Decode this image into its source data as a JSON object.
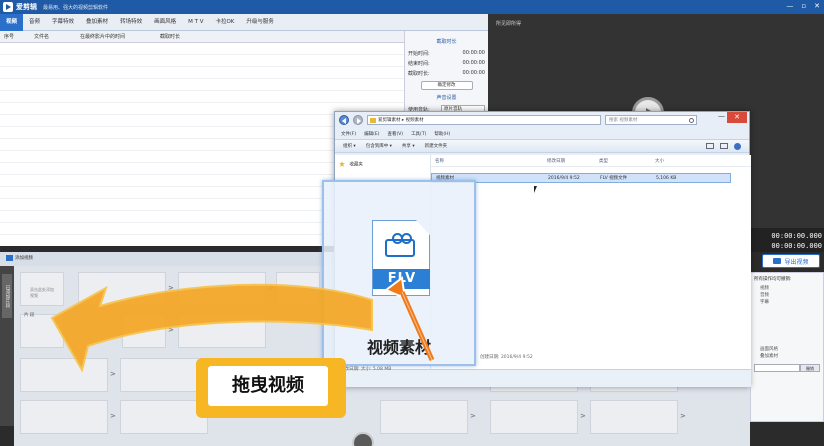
{
  "app": {
    "title": "爱剪辑",
    "tagline": "最易用、强大的视频剪辑软件",
    "window_controls": [
      "—",
      "▫",
      "✕"
    ]
  },
  "menu_tabs": [
    "视频",
    "音频",
    "字幕特效",
    "叠加素材",
    "转场特效",
    "画面风格",
    "M T V",
    "卡拉OK",
    "升级与服务"
  ],
  "list_columns": [
    "序号",
    "文件名",
    "在最终影片中的时间",
    "截取时长"
  ],
  "settings": {
    "title1": "截取时长",
    "rows": [
      {
        "label": "开始时间:",
        "value": "00:00:00"
      },
      {
        "label": "结束时间:",
        "value": "00:00:00"
      },
      {
        "label": "截取时长:",
        "value": "00:00:00"
      }
    ],
    "button": "确定修改",
    "title2": "声音设置",
    "select_label": "使用音轨:",
    "select_value": "原片音轨"
  },
  "preview": {
    "label": "所见即所得",
    "time_current": "00:00:00.000",
    "time_total": "00:00:00.000",
    "export_label": "导出视频"
  },
  "options": {
    "title": "所有操作均可撤销:",
    "items": [
      "视频",
      "音频",
      "字幕",
      "画面风格",
      "叠加素材"
    ],
    "field_value": "",
    "field_button": "撤销"
  },
  "timeline": {
    "add_video": "添加视频",
    "side_tab": "已添加片段",
    "clip_hint": "双击此处添加视频",
    "clip_name": "片 段"
  },
  "explorer": {
    "address": "爱剪辑素材 ▸ 视频素材",
    "search_placeholder": "搜索 视频素材",
    "menu": [
      "文件(F)",
      "编辑(E)",
      "查看(V)",
      "工具(T)",
      "帮助(H)"
    ],
    "toolbar": [
      "组织 ▾",
      "包含到库中 ▾",
      "共享 ▾",
      "新建文件夹"
    ],
    "nav_item": "收藏夹",
    "columns": [
      "名称",
      "修改日期",
      "类型",
      "大小"
    ],
    "file_row": [
      "视频素材",
      "2016/9/4 9:52",
      "FLV 视频文件",
      "5,106 KB"
    ],
    "status_date": "创建日期: 2016/9/4 9:52",
    "status_size": "修改日期: 大小: 5.08 MB"
  },
  "drag_card": {
    "file_ext": "FLV",
    "label": "视频素材"
  },
  "callout": {
    "text": "拖曳视频"
  },
  "colors": {
    "accent": "#2a6fca",
    "callout": "#f7b624",
    "arrow": "#f4a623"
  }
}
